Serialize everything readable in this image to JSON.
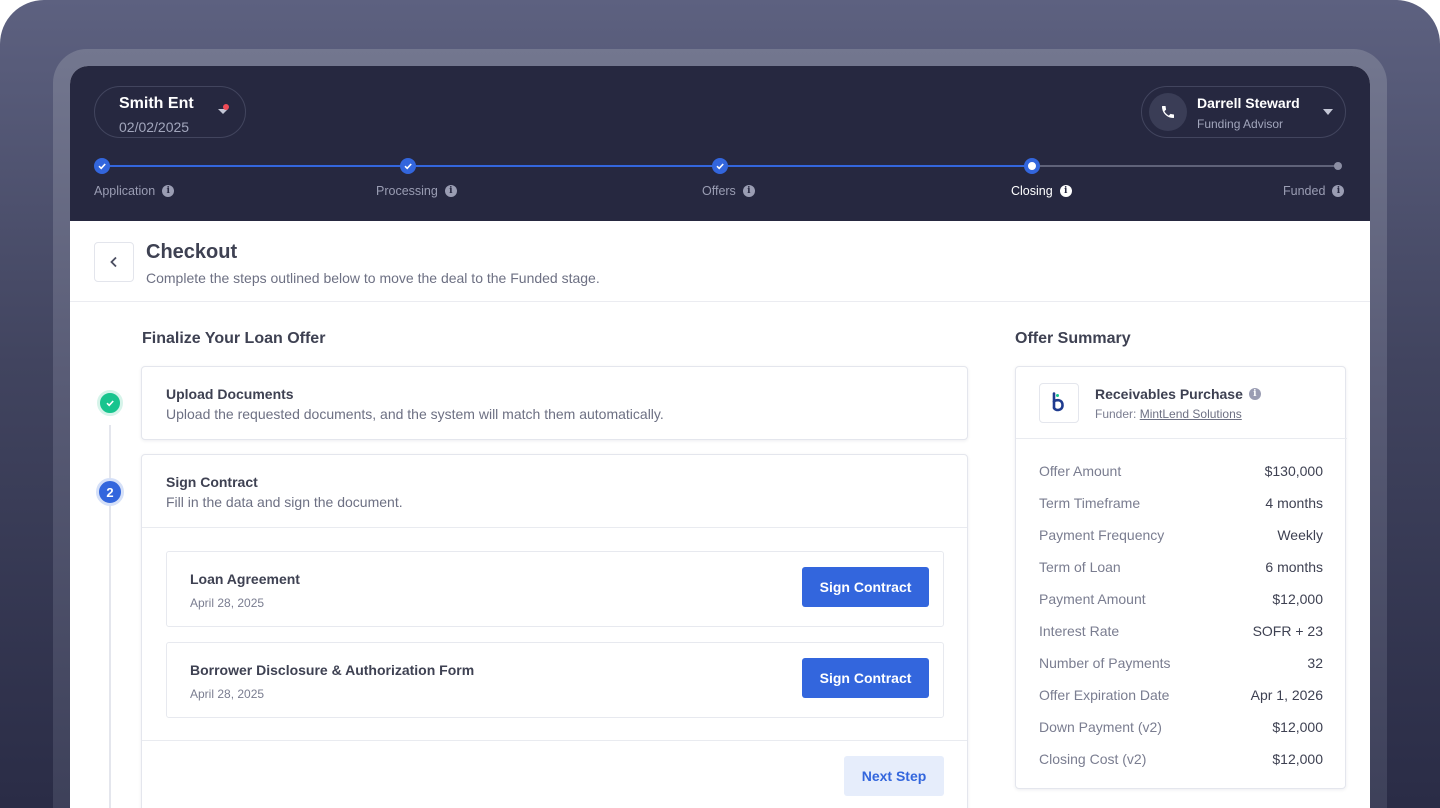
{
  "header": {
    "company": {
      "name": "Smith Ent",
      "date": "02/02/2025"
    },
    "advisor": {
      "name": "Darrell Steward",
      "role": "Funding Advisor"
    },
    "steps": [
      {
        "label": "Application",
        "status": "complete"
      },
      {
        "label": "Processing",
        "status": "complete"
      },
      {
        "label": "Offers",
        "status": "complete"
      },
      {
        "label": "Closing",
        "status": "current"
      },
      {
        "label": "Funded",
        "status": "upcoming"
      }
    ]
  },
  "page": {
    "title": "Checkout",
    "subtitle": "Complete the steps outlined below to move the deal to the Funded stage."
  },
  "finalize": {
    "title": "Finalize Your Loan Offer",
    "upload": {
      "title": "Upload Documents",
      "description": "Upload the requested documents, and the system will match them automatically.",
      "status": "complete"
    },
    "sign": {
      "step_number": "2",
      "title": "Sign Contract",
      "description": "Fill in the data and sign the document.",
      "documents": [
        {
          "title": "Loan Agreement",
          "date": "April 28, 2025",
          "button": "Sign Contract"
        },
        {
          "title": "Borrower Disclosure & Authorization Form",
          "date": "April 28, 2025",
          "button": "Sign Contract"
        }
      ],
      "next_button": "Next Step"
    }
  },
  "summary": {
    "title": "Offer Summary",
    "product": "Receivables Purchase",
    "funder_label": "Funder:",
    "funder_name": "MintLend Solutions",
    "rows": [
      {
        "label": "Offer Amount",
        "value": "$130,000"
      },
      {
        "label": "Term Timeframe",
        "value": "4 months"
      },
      {
        "label": "Payment Frequency",
        "value": "Weekly"
      },
      {
        "label": "Term of Loan",
        "value": "6 months"
      },
      {
        "label": "Payment Amount",
        "value": "$12,000"
      },
      {
        "label": "Interest Rate",
        "value": "SOFR + 23"
      },
      {
        "label": "Number of Payments",
        "value": "32"
      },
      {
        "label": "Offer Expiration Date",
        "value": "Apr 1, 2026"
      },
      {
        "label": "Down Payment (v2)",
        "value": "$12,000"
      },
      {
        "label": "Closing Cost (v2)",
        "value": "$12,000"
      }
    ]
  },
  "colors": {
    "accent": "#3366dd",
    "header_bg": "#262840",
    "success": "#18c48e",
    "notification": "#ef4b57"
  },
  "icons": [
    "chevron-down-icon",
    "phone-icon",
    "check-icon",
    "info-icon",
    "chevron-left-icon",
    "brand-logo-icon"
  ]
}
